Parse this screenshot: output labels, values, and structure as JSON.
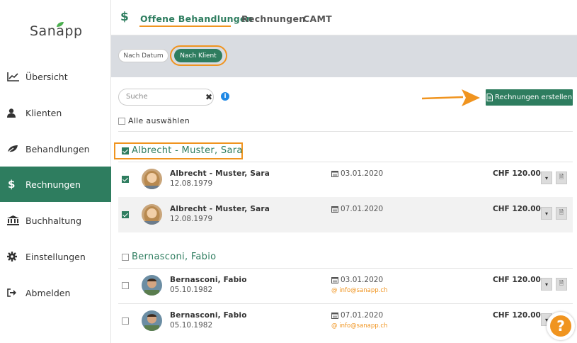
{
  "brand": {
    "logo_text": "Sanapp",
    "accent": "#2e7d5f",
    "highlight": "#f0941f"
  },
  "sidebar": {
    "items": [
      {
        "label": "Übersicht",
        "icon": "chart-line-icon"
      },
      {
        "label": "Klienten",
        "icon": "user-icon"
      },
      {
        "label": "Behandlungen",
        "icon": "leaf-icon"
      },
      {
        "label": "Rechnungen",
        "icon": "dollar-icon",
        "active": true
      },
      {
        "label": "Buchhaltung",
        "icon": "bank-icon"
      },
      {
        "label": "Einstellungen",
        "icon": "gear-icon"
      },
      {
        "label": "Abmelden",
        "icon": "logout-icon"
      }
    ]
  },
  "header": {
    "section_icon": "$",
    "tabs": [
      {
        "label": "Offene Behandlungen",
        "active": true
      },
      {
        "label": "Rechnungen"
      },
      {
        "label": "CAMT"
      }
    ]
  },
  "filters": {
    "by_date": "Nach Datum",
    "by_client": "Nach Klient",
    "selected": "Nach Klient"
  },
  "toolbar": {
    "search_placeholder": "Suche",
    "clear": "✖",
    "info": "i",
    "create_button": "Rechnungen erstellen",
    "select_all": "Alle auswählen"
  },
  "groups": [
    {
      "title": "Albrecht - Muster, Sara",
      "checked": true,
      "rows": [
        {
          "name": "Albrecht - Muster, Sara",
          "dob": "12.08.1979",
          "date": "03.01.2020",
          "email": "",
          "amount": "CHF 120.00",
          "checked": true
        },
        {
          "name": "Albrecht - Muster, Sara",
          "dob": "12.08.1979",
          "date": "07.01.2020",
          "email": "",
          "amount": "CHF 120.00",
          "checked": true
        }
      ]
    },
    {
      "title": "Bernasconi, Fabio",
      "checked": false,
      "rows": [
        {
          "name": "Bernasconi, Fabio",
          "dob": "05.10.1982",
          "date": "03.01.2020",
          "email": "info@sanapp.ch",
          "amount": "CHF 120.00",
          "checked": false
        },
        {
          "name": "Bernasconi, Fabio",
          "dob": "05.10.1982",
          "date": "07.01.2020",
          "email": "info@sanapp.ch",
          "amount": "CHF 120.00",
          "checked": false
        }
      ]
    }
  ],
  "help": {
    "label": "?"
  }
}
